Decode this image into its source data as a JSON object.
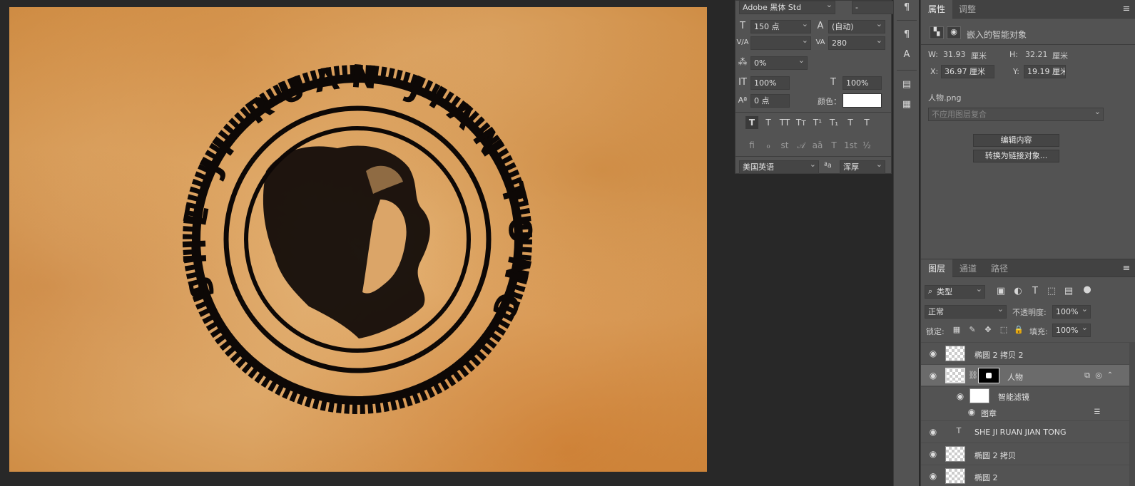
{
  "document": {
    "stamp_text": "SHE JI RUAN JIAN TONG"
  },
  "character": {
    "font_family": "Adobe 黑体 Std",
    "font_style": "-",
    "size": "150 点",
    "leading": "(自动)",
    "kerning": "",
    "tracking": "280",
    "tsume": "0%",
    "vscale": "100%",
    "hscale": "100%",
    "baseline": "0 点",
    "color_label": "颜色：",
    "style_buttons": [
      "T",
      "T",
      "TT",
      "Tт",
      "T¹",
      "T₁",
      "T",
      "T"
    ],
    "opentype_buttons": [
      "fi",
      "ℴ",
      "st",
      "𝒜",
      "aā",
      "T",
      "1st",
      "½"
    ],
    "language": "美国英语",
    "aa_icon": "ªa",
    "antialias": "浑厚"
  },
  "properties": {
    "tabs": [
      "属性",
      "调整"
    ],
    "type_label": "嵌入的智能对象",
    "w_label": "W:",
    "w_value": "31.93",
    "w_unit": "厘米",
    "h_label": "H:",
    "h_value": "32.21",
    "h_unit": "厘米",
    "x_label": "X:",
    "x_value": "36.97 厘米",
    "y_label": "Y:",
    "y_value": "19.19 厘米",
    "source_file": "人物.png",
    "comp_placeholder": "不应用图层复合",
    "edit_button": "编辑内容",
    "convert_button": "转换为链接对象..."
  },
  "layers_panel": {
    "tabs": [
      "图层",
      "通道",
      "路径"
    ],
    "filter_kind": "类型",
    "blend_mode": "正常",
    "opacity_label": "不透明度:",
    "opacity": "100%",
    "lock_label": "锁定:",
    "fill_label": "填充:",
    "fill": "100%",
    "layers": [
      {
        "name": "椭圆 2 拷贝 2"
      },
      {
        "name": "人物"
      },
      {
        "name": "智能滤镜"
      },
      {
        "name": "图章"
      },
      {
        "name": "SHE JI RUAN JIAN TONG"
      },
      {
        "name": "椭圆 2 拷贝"
      },
      {
        "name": "椭圆 2"
      }
    ]
  }
}
